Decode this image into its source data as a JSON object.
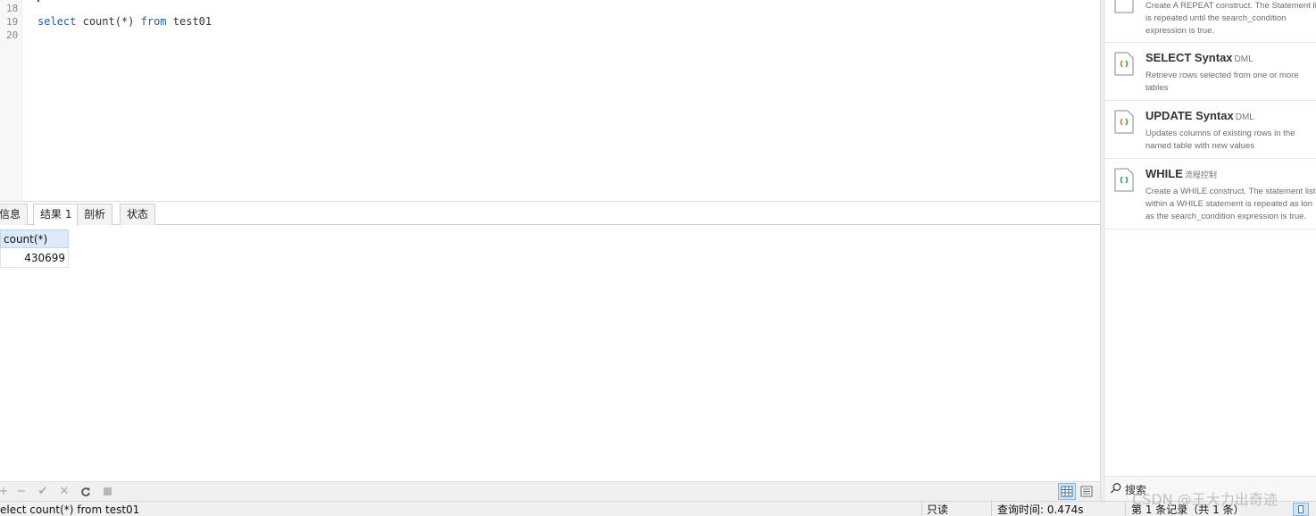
{
  "editor": {
    "line_numbers": [
      "18",
      "19",
      "20"
    ],
    "code_line": {
      "keyword_select": "select",
      "func": "count(*)",
      "keyword_from": "from",
      "table": "test01"
    }
  },
  "result_tabs": [
    {
      "label": "信息"
    },
    {
      "label": "结果 1"
    },
    {
      "label": "剖析"
    },
    {
      "label": "状态"
    }
  ],
  "grid": {
    "columns": [
      "count(*)"
    ],
    "rows": [
      [
        "430699"
      ]
    ]
  },
  "toolbar": {
    "buttons": [
      "add-icon",
      "delete-icon",
      "apply-icon",
      "discard-icon",
      "refresh-icon",
      "stop-icon"
    ],
    "views": [
      "grid-view-icon",
      "form-view-icon"
    ]
  },
  "status": {
    "query": "elect count(*) from test01",
    "readonly": "只读",
    "query_time": "查询时间: 0.474s",
    "records": "第 1 条记录（共 1 条）"
  },
  "snippets": [
    {
      "title": "",
      "tag": "",
      "desc": [
        "Create A REPEAT construct. The Statement li",
        "is repeated until the search_condition",
        "expression is true."
      ]
    },
    {
      "title": "SELECT Syntax",
      "tag": "DML",
      "desc": [
        "Retrieve rows selected from one or more",
        "tables"
      ]
    },
    {
      "title": "UPDATE Syntax",
      "tag": "DML",
      "desc": [
        "Updates columns of existing rows in the",
        "named table with new values"
      ]
    },
    {
      "title": "WHILE",
      "tag": "流程控制",
      "desc": [
        "Create a WHILE construct. The statement list",
        "within a WHILE statement is repeated as lon",
        "as the search_condition expression is true."
      ]
    }
  ],
  "right_search": {
    "label": "搜索"
  },
  "watermark": "CSDN @王大力出奇迹",
  "colors": {
    "keyword": "#1a5fb4",
    "grid_header": "#dce9f8",
    "accent_icon_orange": "#e8772e",
    "accent_icon_green": "#3aa655"
  }
}
